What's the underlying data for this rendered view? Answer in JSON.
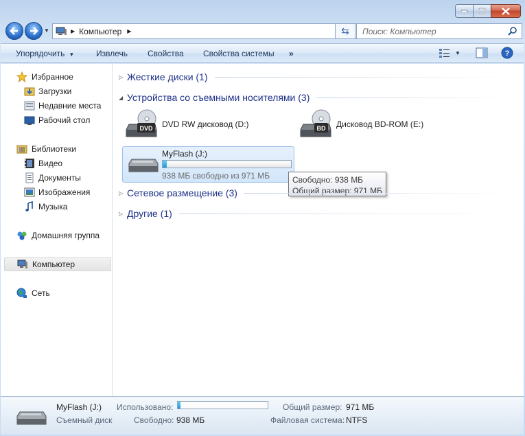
{
  "window": {
    "accent": "#c3d9f1",
    "buttons": [
      "minimize-icon",
      "maximize-icon",
      "close-icon"
    ]
  },
  "address": {
    "crumb": "Компьютер",
    "search_placeholder": "Поиск: Компьютер"
  },
  "toolbar": {
    "organize": "Упорядочить",
    "eject": "Извлечь",
    "properties": "Свойства",
    "system_properties": "Свойства системы",
    "more": "»"
  },
  "sidebar": {
    "favorites": "Избранное",
    "downloads": "Загрузки",
    "recent": "Недавние места",
    "desktop": "Рабочий стол",
    "libraries": "Библиотеки",
    "video": "Видео",
    "documents": "Документы",
    "images": "Изображения",
    "music": "Музыка",
    "homegroup": "Домашняя группа",
    "computer": "Компьютер",
    "network": "Сеть"
  },
  "groups": {
    "hard_disks": "Жесткие диски (1)",
    "removable": "Устройства со съемными носителями (3)",
    "network": "Сетевое размещение (3)",
    "other": "Другие (1)"
  },
  "drives": {
    "dvd": {
      "label": "DVD RW дисковод (D:)",
      "badge": "DVD"
    },
    "bd": {
      "label": "Дисковод BD-ROM (E:)",
      "badge": "BD"
    },
    "flash": {
      "label": "MyFlash (J:)",
      "free_text": "938 МБ свободно из 971 МБ",
      "used_fraction": 0.034
    }
  },
  "tooltip": {
    "line1": "Свободно: 938 МБ",
    "line2": "Общий размер: 971 МБ"
  },
  "details": {
    "name": "MyFlash (J:)",
    "type": "Съемный диск",
    "used_label": "Использовано:",
    "free_label": "Свободно:",
    "free_value": "938 МБ",
    "total_label": "Общий размер:",
    "total_value": "971 МБ",
    "fs_label": "Файловая система:",
    "fs_value": "NTFS"
  }
}
